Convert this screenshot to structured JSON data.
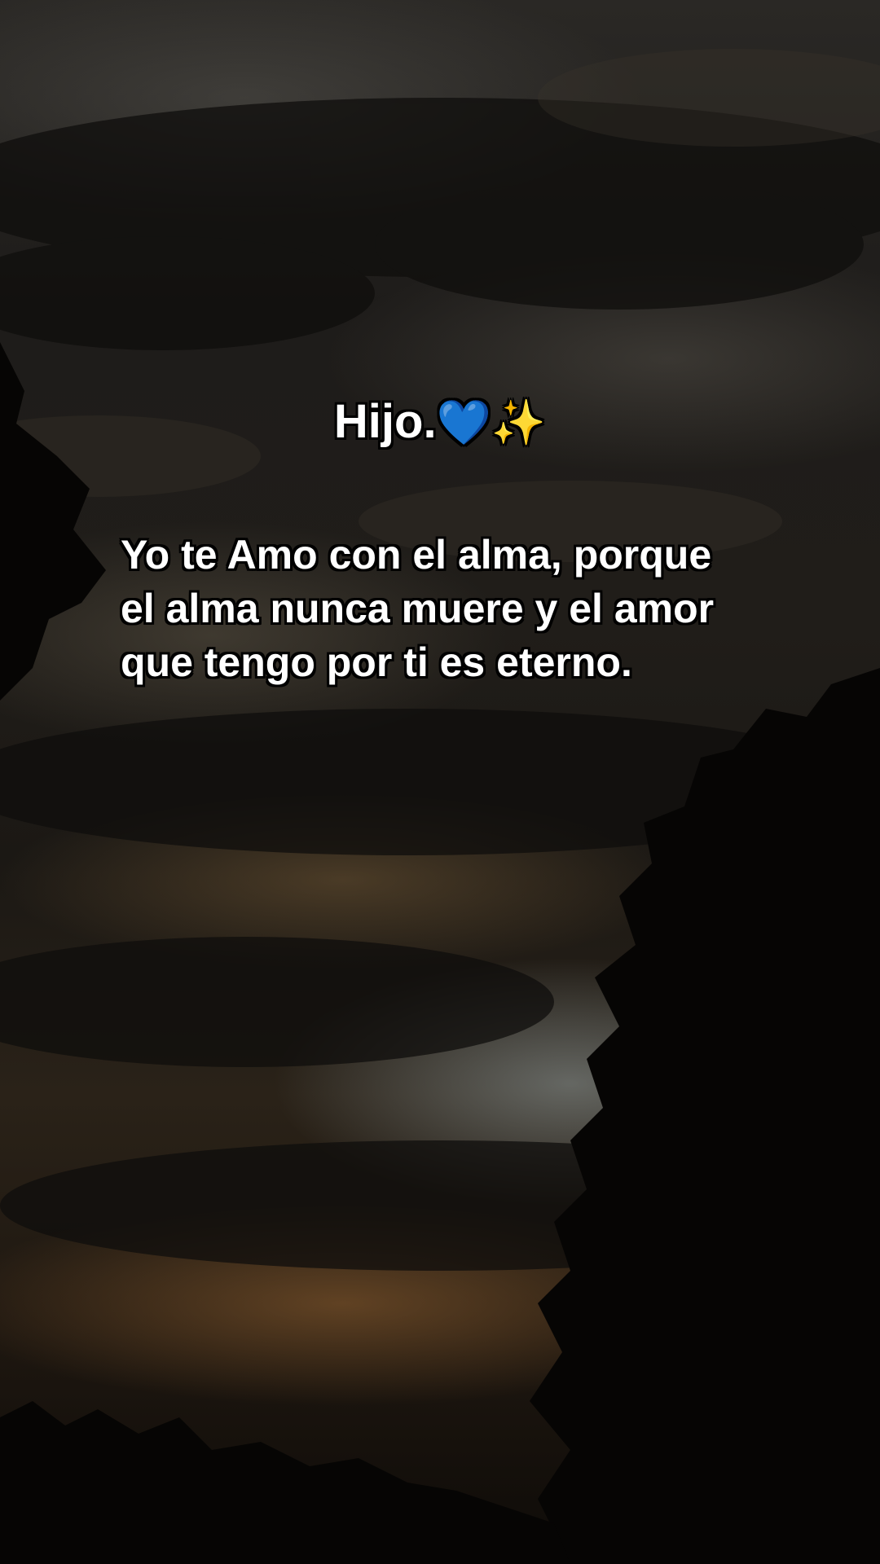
{
  "caption": {
    "title": "Hijo.",
    "title_emojis": "💙✨",
    "body": "Yo te Amo con el alma, porque\nel alma nunca muere y el amor\nque tengo por ti es eterno."
  },
  "colors": {
    "text": "#ffffff",
    "outline": "#000000",
    "heart": "#2f7cf6",
    "sparkles": "#f5c842"
  }
}
